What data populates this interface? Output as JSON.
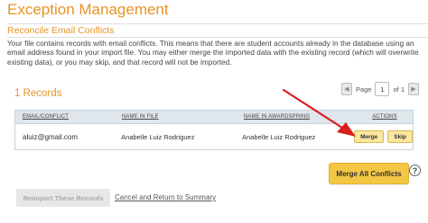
{
  "page": {
    "title": "Exception Management",
    "subtitle": "Reconcile Email Conflicts",
    "description": "Your file contains records with email conflicts. This means that there are student accounts already in the database using an email address found in your import file. You may either merge the imported data with the existing record (which will overwrite existing data), or you may skip, and that record will not be imported."
  },
  "records": {
    "count_label": "1 Records"
  },
  "pager": {
    "prev_icon": "chevron-left-icon",
    "next_icon": "chevron-right-icon",
    "page_label": "Page",
    "current_page": "1",
    "of_label": "of 1"
  },
  "table": {
    "headers": {
      "email": "EMAIL/CONFLICT",
      "name_in_file": "NAME IN FILE",
      "name_in_awardspring": "NAME IN AWARDSPRING",
      "actions": "ACTIONS"
    },
    "rows": [
      {
        "email": "aluiz@gmail.com",
        "name_in_file": "Anabelle Luiz Rodriguez",
        "name_in_awardspring": "Anabelle Luiz Rodriguez",
        "merge_label": "Merge",
        "skip_label": "Skip"
      }
    ]
  },
  "footer": {
    "merge_all_label": "Merge All Conflicts",
    "help_icon": "help-icon",
    "reimport_label": "Reimport These Records",
    "cancel_label": "Cancel and Return to Summary"
  },
  "colors": {
    "accent_orange": "#e89327",
    "button_yellow": "#f3c644",
    "annotation_red": "#d81e1e"
  }
}
